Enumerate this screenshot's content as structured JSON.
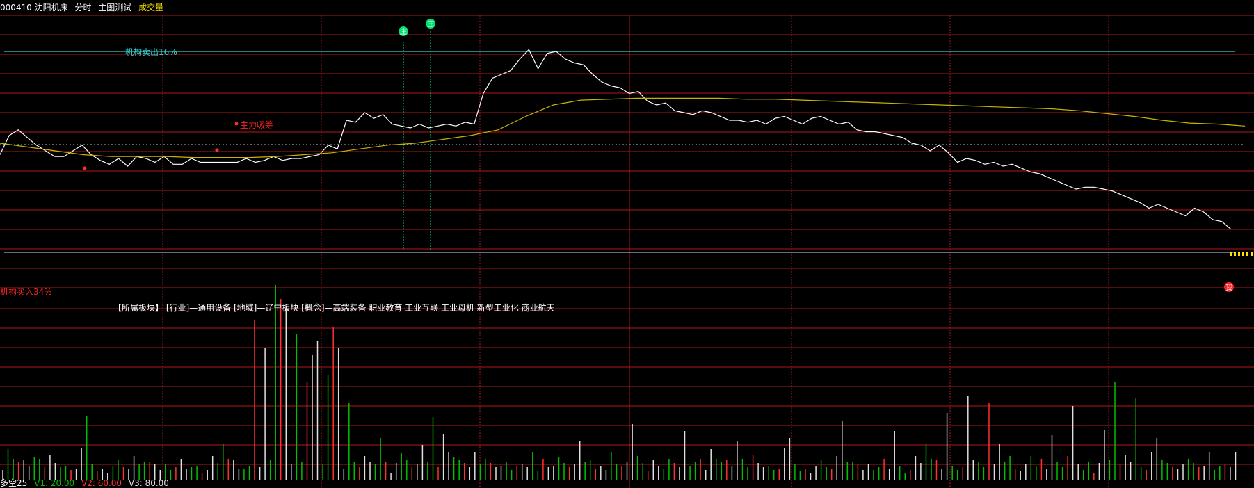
{
  "header": {
    "code_name": "000410 沈阳机床",
    "period": "分时",
    "indicator": "主图测试",
    "volume_label": "成交量"
  },
  "annotations": {
    "sell_label": "机构卖出16%",
    "buy_label": "机构买入34%",
    "main_buy_label": "主力吸筹",
    "sector_info": "【所属板块】 [行业]—通用设备 [地域]—辽宁板块 [概念]—高端装备 职业教育 工业互联 工业母机 新型工业化 商业航天",
    "badge_top_1": "庄",
    "badge_top_2": "庄",
    "badge_right": "我"
  },
  "footer": {
    "indicator_name": "多空25",
    "v1": "V1: 20.00",
    "v2": "V2: 60.00",
    "v3": "V3: 80.00"
  },
  "colors": {
    "background": "#000000",
    "grid": "#b01818",
    "price_line": "#ffffff",
    "avg_line": "#c8b400",
    "sell_line": "#33cccc",
    "buy_line": "#ff2222",
    "vol_up": "#ff3030",
    "vol_down": "#00c000",
    "vol_flat": "#e0e0e0",
    "marker_green": "#00e070",
    "text_white": "#ffffff",
    "text_yellow": "#e6d200"
  },
  "chart_data": {
    "type": "line",
    "series": [
      {
        "name": "price",
        "values": [
          5.0,
          6.0,
          6.3,
          5.9,
          5.5,
          5.2,
          4.9,
          4.9,
          5.2,
          5.5,
          5.0,
          4.7,
          4.5,
          4.8,
          4.4,
          4.9,
          4.8,
          4.6,
          4.9,
          4.5,
          4.5,
          4.8,
          4.6,
          4.6,
          4.6,
          4.6,
          4.6,
          4.8,
          4.6,
          4.7,
          4.9,
          4.7,
          4.8,
          4.8,
          4.9,
          5.0,
          5.5,
          5.3,
          6.8,
          6.7,
          7.2,
          6.9,
          7.1,
          6.6,
          6.5,
          6.4,
          6.6,
          6.4,
          6.5,
          6.6,
          6.5,
          6.7,
          6.6,
          8.2,
          9.0,
          9.2,
          9.4,
          10.0,
          10.5,
          9.5,
          10.3,
          10.4,
          10.0,
          9.8,
          9.7,
          9.2,
          8.8,
          8.6,
          8.5,
          8.2,
          8.3,
          7.8,
          7.6,
          7.7,
          7.3,
          7.2,
          7.1,
          7.3,
          7.2,
          7.0,
          6.8,
          6.8,
          6.7,
          6.8,
          6.6,
          6.9,
          7.0,
          6.8,
          6.6,
          6.9,
          7.0,
          6.8,
          6.6,
          6.7,
          6.3,
          6.2,
          6.2,
          6.1,
          6.0,
          5.9,
          5.6,
          5.5,
          5.2,
          5.5,
          5.1,
          4.6,
          4.8,
          4.7,
          4.5,
          4.6,
          4.4,
          4.5,
          4.3,
          4.1,
          4.0,
          3.8,
          3.6,
          3.4,
          3.2,
          3.3,
          3.3,
          3.2,
          3.1,
          2.9,
          2.7,
          2.5,
          2.2,
          2.4,
          2.2,
          2.0,
          1.8,
          2.2,
          2.0,
          1.6,
          1.5,
          1.1
        ]
      },
      {
        "name": "avg",
        "values": [
          5.6,
          5.4,
          5.2,
          5.0,
          4.9,
          4.9,
          4.9,
          4.85,
          4.85,
          4.85,
          4.9,
          5.0,
          5.1,
          5.3,
          5.5,
          5.6,
          5.8,
          6.0,
          6.3,
          7.0,
          7.6,
          7.85,
          7.9,
          7.95,
          7.95,
          7.95,
          7.95,
          7.9,
          7.9,
          7.85,
          7.8,
          7.75,
          7.7,
          7.65,
          7.6,
          7.55,
          7.5,
          7.45,
          7.4,
          7.3,
          7.15,
          7.0,
          6.8,
          6.65,
          6.6,
          6.5
        ]
      }
    ],
    "ylim": [
      0,
      12
    ],
    "grid": true
  }
}
